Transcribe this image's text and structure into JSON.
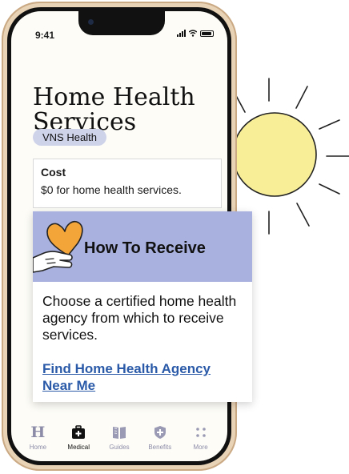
{
  "status_bar": {
    "time": "9:41",
    "icons": [
      "signal-icon",
      "wifi-icon",
      "battery-icon"
    ]
  },
  "page": {
    "title": "Home Health Services",
    "provider_badge": "VNS Health"
  },
  "cost": {
    "title": "Cost",
    "text": "$0 for home health services."
  },
  "how_to_receive": {
    "title": "How To Receive",
    "description": "Choose a certified home health agency from which to receive services.",
    "link_label": "Find Home Health Agency Near Me"
  },
  "tab_bar": {
    "items": [
      {
        "label": "Home",
        "icon": "home-h-icon",
        "active": false
      },
      {
        "label": "Medical",
        "icon": "medical-bag-icon",
        "active": true
      },
      {
        "label": "Guides",
        "icon": "book-icon",
        "active": false
      },
      {
        "label": "Benefits",
        "icon": "shield-icon",
        "active": false
      },
      {
        "label": "More",
        "icon": "more-dots-icon",
        "active": false
      }
    ]
  },
  "colors": {
    "accent_link": "#2a5aa8",
    "badge_bg": "#cfd3ea",
    "popout_header": "#a9b1df",
    "sun": "#f8ee98",
    "heart": "#f4a53a",
    "phone_frame": "#e9d3b6"
  }
}
